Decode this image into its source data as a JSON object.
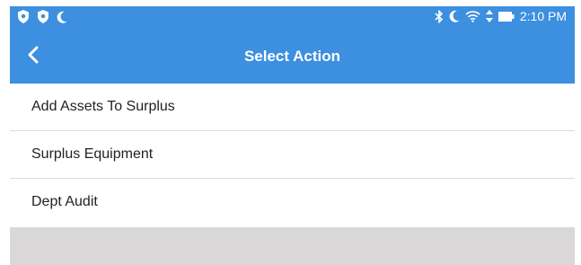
{
  "status_bar": {
    "left_icons": [
      "shield-icon",
      "shield-icon",
      "moon-icon"
    ],
    "right_icons": [
      "bluetooth-icon",
      "moon-icon",
      "wifi-icon",
      "data-arrows-icon",
      "battery-icon"
    ],
    "time": "2:10 PM"
  },
  "app_bar": {
    "title": "Select Action",
    "back_icon": "chevron-left-icon",
    "color": "#3d8fe0"
  },
  "actions": [
    {
      "label": "Add Assets To Surplus"
    },
    {
      "label": "Surplus Equipment"
    },
    {
      "label": "Dept Audit"
    }
  ],
  "colors": {
    "accent": "#3d8fe0",
    "bottom_area": "#d9d7d7",
    "divider": "#dcdcdc"
  }
}
